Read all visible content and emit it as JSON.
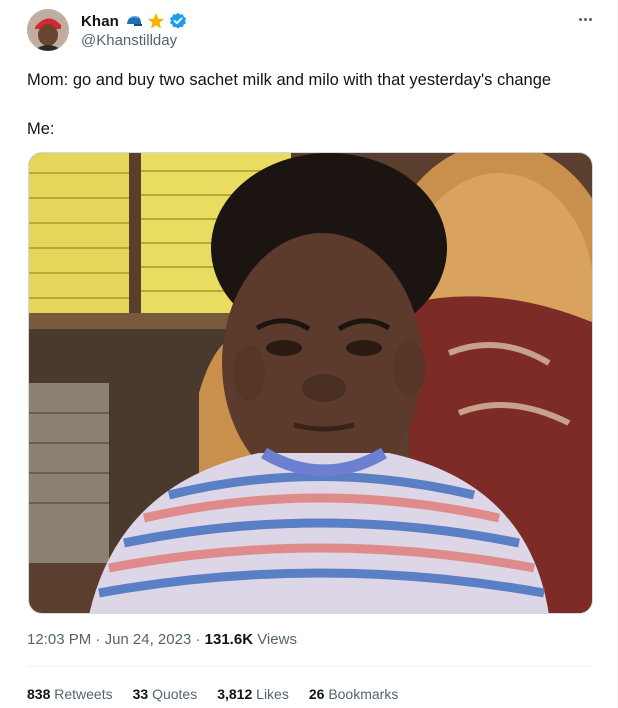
{
  "author": {
    "display_name": "Khan",
    "handle": "@Khanstillday",
    "badges": [
      "cap-icon",
      "star-icon",
      "verified-icon"
    ]
  },
  "tweet": {
    "line1": "Mom: go and buy two sachet milk and milo with that yesterday's change",
    "line2": "Me:"
  },
  "meta": {
    "time": "12:03 PM",
    "separator": "·",
    "date": "Jun 24, 2023",
    "views_count": "131.6K",
    "views_label": "Views"
  },
  "stats": {
    "retweets_count": "838",
    "retweets_label": "Retweets",
    "quotes_count": "33",
    "quotes_label": "Quotes",
    "likes_count": "3,812",
    "likes_label": "Likes",
    "bookmarks_count": "26",
    "bookmarks_label": "Bookmarks"
  },
  "colors": {
    "verified": "#1d9bf0",
    "star": "#f4b400",
    "cap": "#1d6fb8",
    "muted": "#536471"
  }
}
